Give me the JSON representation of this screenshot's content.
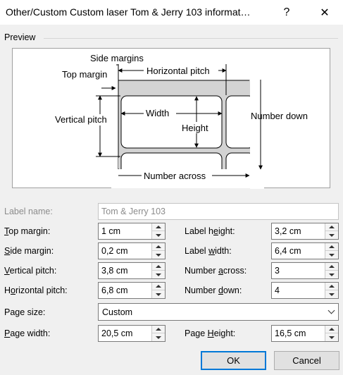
{
  "window": {
    "title": "Other/Custom Custom laser Tom & Jerry 103 informat…",
    "help_label": "?",
    "close_label": "✕"
  },
  "preview": {
    "section_label": "Preview",
    "diagram": {
      "side_margins": "Side margins",
      "top_margin": "Top margin",
      "horizontal_pitch": "Horizontal pitch",
      "vertical_pitch": "Vertical pitch",
      "width": "Width",
      "height": "Height",
      "number_down": "Number down",
      "number_across": "Number across"
    }
  },
  "form": {
    "label_name": {
      "label": "Label name:",
      "value": "Tom & Jerry 103"
    },
    "top_margin": {
      "label_key": "T",
      "label_rest": "op margin:",
      "value": "1 cm"
    },
    "side_margin": {
      "label_key": "S",
      "label_rest": "ide margin:",
      "value": "0,2 cm"
    },
    "vertical_pitch": {
      "label_key": "V",
      "label_rest": "ertical pitch:",
      "value": "3,8 cm"
    },
    "horizontal_pitch": {
      "label_pre": "H",
      "label_key": "o",
      "label_rest": "rizontal pitch:",
      "value": "6,8 cm"
    },
    "label_height": {
      "label_pre": "Label h",
      "label_key": "e",
      "label_rest": "ight:",
      "value": "3,2 cm"
    },
    "label_width": {
      "label_pre": "Label ",
      "label_key": "w",
      "label_rest": "idth:",
      "value": "6,4 cm"
    },
    "number_across": {
      "label_pre": "Number ",
      "label_key": "a",
      "label_rest": "cross:",
      "value": "3"
    },
    "number_down": {
      "label_pre": "Number ",
      "label_key": "d",
      "label_rest": "own:",
      "value": "4"
    },
    "page_size": {
      "label": "Page size:",
      "value": "Custom"
    },
    "page_width": {
      "label_key": "P",
      "label_rest": "age width:",
      "value": "20,5 cm"
    },
    "page_height": {
      "label_pre": "Page ",
      "label_key": "H",
      "label_rest": "eight:",
      "value": "16,5 cm"
    }
  },
  "buttons": {
    "ok": "OK",
    "cancel": "Cancel"
  },
  "colors": {
    "accent": "#0078d7",
    "label_fill": "#d3d3d3",
    "disabled_text": "#8c8c8c"
  }
}
